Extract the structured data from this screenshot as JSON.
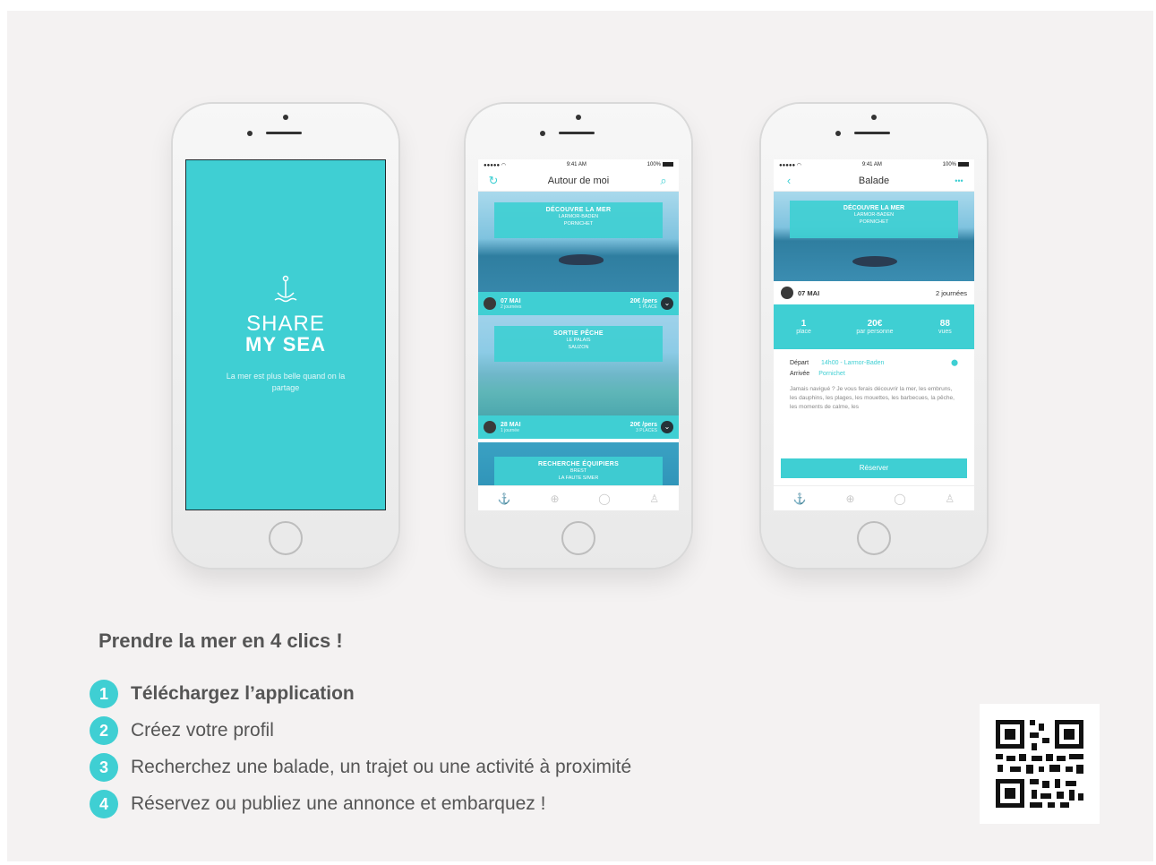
{
  "splash": {
    "brand_line1": "SHARE",
    "brand_line2": "MY SEA",
    "tagline": "La mer est plus belle quand on la partage"
  },
  "list_screen": {
    "status_time": "9:41 AM",
    "status_battery": "100%",
    "title": "Autour de moi",
    "cards": [
      {
        "title": "DÉCOUVRE LA MER",
        "subtitle1": "LARMOR-BADEN",
        "subtitle2": "PORNICHET",
        "date": "07 MAI",
        "duration": "2 journées",
        "price": "20€ /pers",
        "places": "1 PLACE"
      },
      {
        "title": "SORTIE PÊCHE",
        "subtitle1": "LE PALAIS",
        "subtitle2": "SAUZON",
        "date": "28 MAI",
        "duration": "1 journée",
        "price": "20€ /pers",
        "places": "3 PLACES"
      },
      {
        "title": "RECHERCHE ÉQUIPIERS",
        "subtitle1": "BREST",
        "subtitle2": "LA FAUTE S/MER"
      }
    ]
  },
  "detail_screen": {
    "status_time": "9:41 AM",
    "status_battery": "100%",
    "title": "Balade",
    "more": "•••",
    "card_title": "DÉCOUVRE LA MER",
    "card_sub1": "LARMOR-BADEN",
    "card_sub2": "PORNICHET",
    "date": "07 MAI",
    "duration": "2 journées",
    "stats": [
      {
        "value": "1",
        "label": "place"
      },
      {
        "value": "20€",
        "label": "par personne"
      },
      {
        "value": "88",
        "label": "vues"
      }
    ],
    "depart_label": "Départ",
    "depart_value": "14h00 - Larmor-Baden",
    "arrivee_label": "Arrivée",
    "arrivee_value": "Pornichet",
    "description": "Jamais navigué ? Je vous ferais découvrir la mer, les embruns, les dauphins, les plages, les mouettes, les barbecues, la pêche, les moments de calme, les",
    "reserve_label": "Réserver"
  },
  "steps": {
    "title": "Prendre la mer en 4 clics !",
    "items": [
      {
        "num": "1",
        "text": "Téléchargez l’application"
      },
      {
        "num": "2",
        "text": "Créez votre profil"
      },
      {
        "num": "3",
        "text": "Recherchez une balade, un trajet ou une activité à proximité"
      },
      {
        "num": "4",
        "text": "Réservez ou publiez une annonce et embarquez !"
      }
    ]
  },
  "colors": {
    "accent": "#3fcfd3",
    "text": "#555555",
    "background": "#f4f2f2"
  },
  "icons": [
    "anchor-logo-icon",
    "refresh-icon",
    "search-icon",
    "back-chevron-icon",
    "pin-icon",
    "tab-anchor-icon",
    "tab-add-icon",
    "tab-chat-icon",
    "tab-profile-icon",
    "qr-code-icon"
  ]
}
